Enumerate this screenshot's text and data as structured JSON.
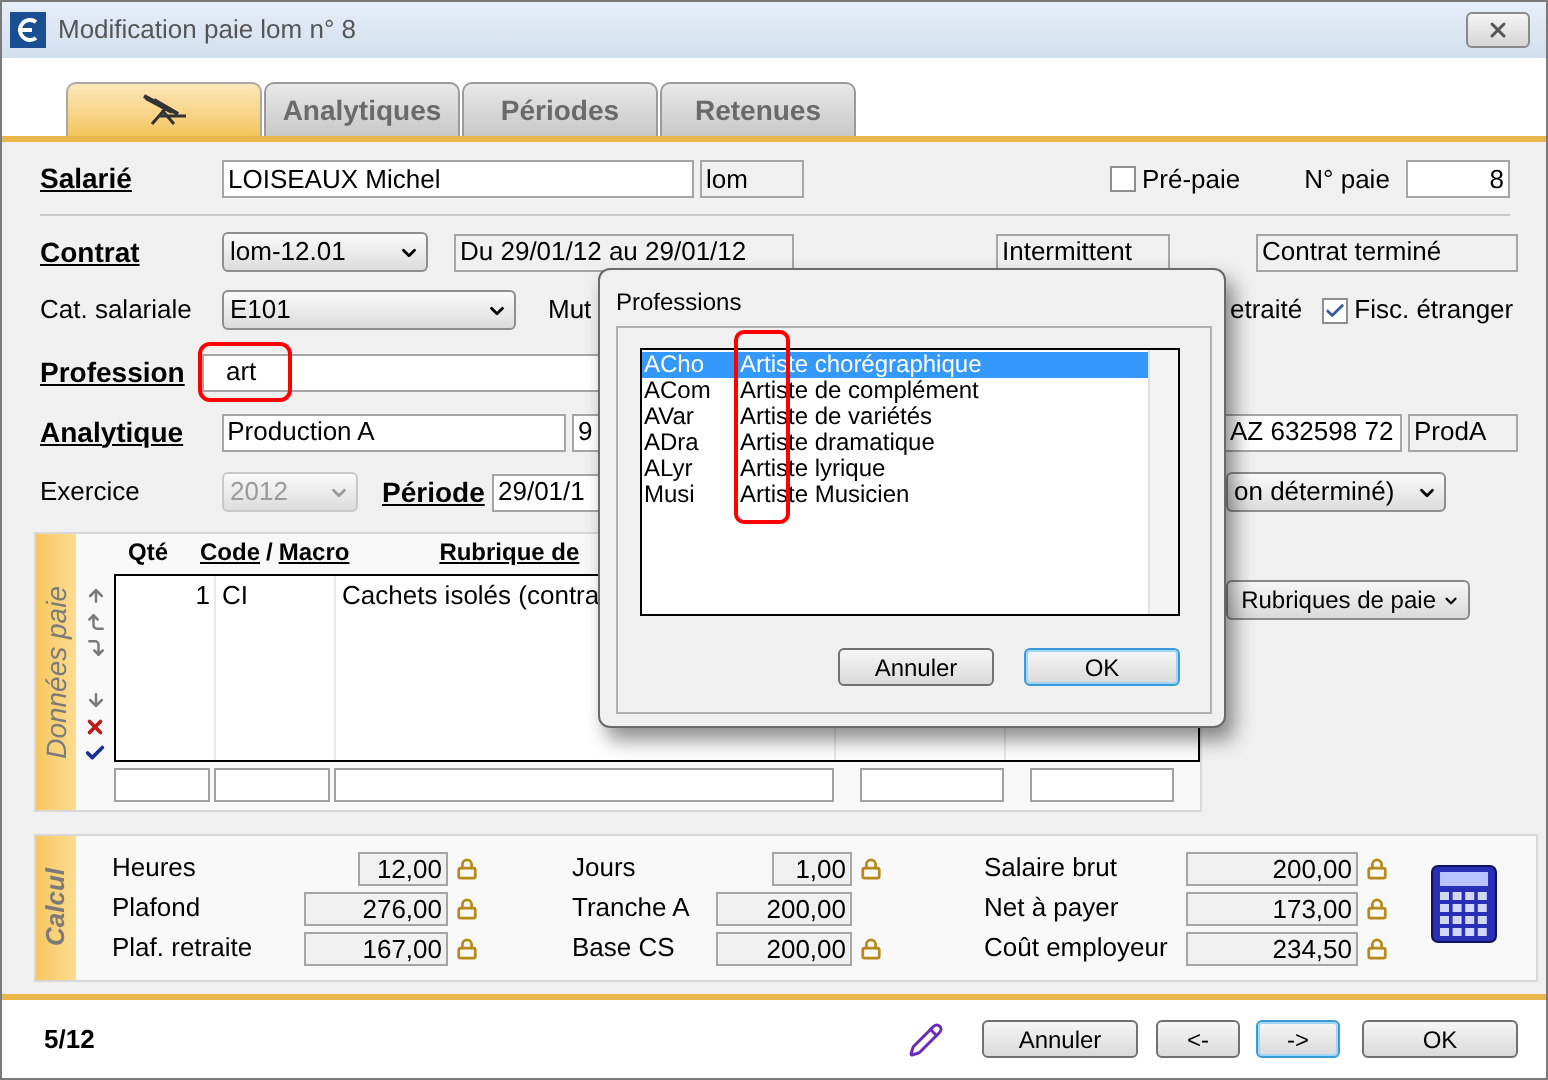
{
  "window": {
    "title": "Modification paie lom n° 8"
  },
  "tabs": [
    {
      "kind": "icon",
      "selected": true
    },
    {
      "kind": "text",
      "label": "Analytiques",
      "selected": false
    },
    {
      "kind": "text",
      "label": "Périodes",
      "selected": false
    },
    {
      "kind": "text",
      "label": "Retenues",
      "selected": false
    }
  ],
  "salarie": {
    "label": "Salarié",
    "name": "LOISEAUX Michel",
    "code": "lom",
    "prepaie": {
      "label": "Pré-paie",
      "checked": false
    },
    "no_paie_label": "N° paie",
    "no_paie": "8"
  },
  "contrat": {
    "label": "Contrat",
    "value": "lom-12.01",
    "dates": "Du 29/01/12 au 29/01/12",
    "type": "Intermittent",
    "status": "Contrat terminé"
  },
  "cat_salariale": {
    "label": "Cat. salariale",
    "value": "E101",
    "mut_label": "Mut",
    "retraite_label": "etraité",
    "fisc_etranger": {
      "label": "Fisc. étranger",
      "checked": true
    }
  },
  "profession": {
    "label": "Profession",
    "value": "art",
    "highlighted": true
  },
  "analytique": {
    "label": "Analytique",
    "value": "Production A",
    "code": "9",
    "siret": "AZ 632598 72",
    "short": "ProdA"
  },
  "exercice": {
    "label": "Exercice",
    "value": "2012",
    "disabled": true
  },
  "periode": {
    "label": "Période",
    "value": "29/01/1",
    "type": "on déterminé)"
  },
  "donnees_paie": {
    "title": "Données paie",
    "header": {
      "qty": "Qté",
      "code": "Code",
      "sep": "/",
      "macro": "Macro",
      "rubrique": "Rubrique de"
    },
    "rows": [
      {
        "qty": "1",
        "code": "CI",
        "rubrique": "Cachets isolés (contra"
      }
    ],
    "button": "Rubriques de paie"
  },
  "calcul": {
    "title": "Calcul",
    "columns": [
      [
        {
          "label": "Heures",
          "value": "12,00",
          "locked": true
        },
        {
          "label": "Plafond",
          "value": "276,00",
          "locked": true
        },
        {
          "label": "Plaf. retraite",
          "value": "167,00",
          "locked": true
        }
      ],
      [
        {
          "label": "Jours",
          "value": "1,00",
          "locked": true
        },
        {
          "label": "Tranche A",
          "value": "200,00",
          "locked": false
        },
        {
          "label": "Base CS",
          "value": "200,00",
          "locked": true
        }
      ],
      [
        {
          "label": "Salaire brut",
          "value": "200,00",
          "locked": true
        },
        {
          "label": "Net à payer",
          "value": "173,00",
          "locked": true
        },
        {
          "label": "Coût employeur",
          "value": "234,50",
          "locked": true
        }
      ]
    ]
  },
  "footer": {
    "page": "5/12",
    "buttons": [
      {
        "label": "Annuler",
        "focused": false
      },
      {
        "label": "<-",
        "focused": false
      },
      {
        "label": "->",
        "focused": true
      },
      {
        "label": "OK",
        "focused": false
      }
    ]
  },
  "dialog": {
    "title": "Professions",
    "highlighted": true,
    "items": [
      {
        "code": "ACho",
        "name": "Artiste chorégraphique",
        "selected": true
      },
      {
        "code": "ACom",
        "name": "Artiste de complément",
        "selected": false
      },
      {
        "code": "AVar",
        "name": "Artiste de variétés",
        "selected": false
      },
      {
        "code": "ADra",
        "name": "Artiste dramatique",
        "selected": false
      },
      {
        "code": "ALyr",
        "name": "Artiste lyrique",
        "selected": false
      },
      {
        "code": "Musi",
        "name": "Artiste Musicien",
        "selected": false
      }
    ],
    "buttons": [
      {
        "label": "Annuler",
        "focused": false
      },
      {
        "label": "OK",
        "focused": true
      }
    ]
  }
}
